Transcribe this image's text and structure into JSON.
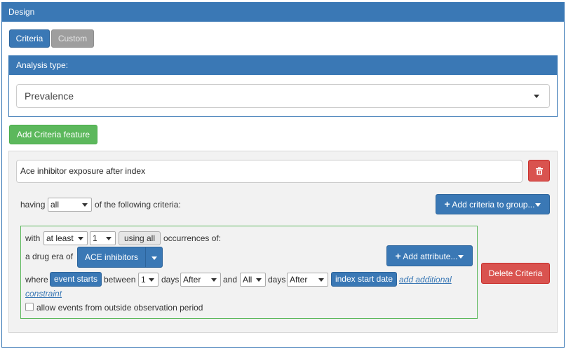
{
  "panel": {
    "title": "Design"
  },
  "tabs": [
    {
      "label": "Criteria",
      "active": true
    },
    {
      "label": "Custom",
      "active": false
    }
  ],
  "analysis": {
    "heading": "Analysis type:",
    "selected": "Prevalence"
  },
  "add_feature_label": "Add Criteria feature",
  "feature": {
    "name_value": "Ace inhibitor exposure after index",
    "having_label": "having",
    "having_value": "all",
    "of_following_label": "of the following criteria:",
    "add_criteria_group_label": "Add criteria to group...",
    "delete_criteria_label": "Delete Criteria"
  },
  "criteria": {
    "with_label": "with",
    "occurrence_type": "at least",
    "occurrence_count": "1",
    "using_all_label": "using all",
    "occurrences_of_label": "occurrences of:",
    "drug_era_label": "a drug era of",
    "concept_set": "ACE inhibitors",
    "add_attribute_label": "Add attribute...",
    "where_label": "where",
    "event_starts_label": "event starts",
    "between_label": "between",
    "start_days": "1",
    "days_label_1": "days",
    "start_direction": "After",
    "and_label": "and",
    "end_days": "All",
    "days_label_2": "days",
    "end_direction": "After",
    "index_start_label": "index start date",
    "add_constraint_line1": "add additional",
    "add_constraint_line2": "constraint",
    "allow_events_label": "allow events from outside observation period"
  },
  "colors": {
    "primary": "#3a78b5",
    "success": "#5cb85c",
    "danger": "#d9534f"
  }
}
